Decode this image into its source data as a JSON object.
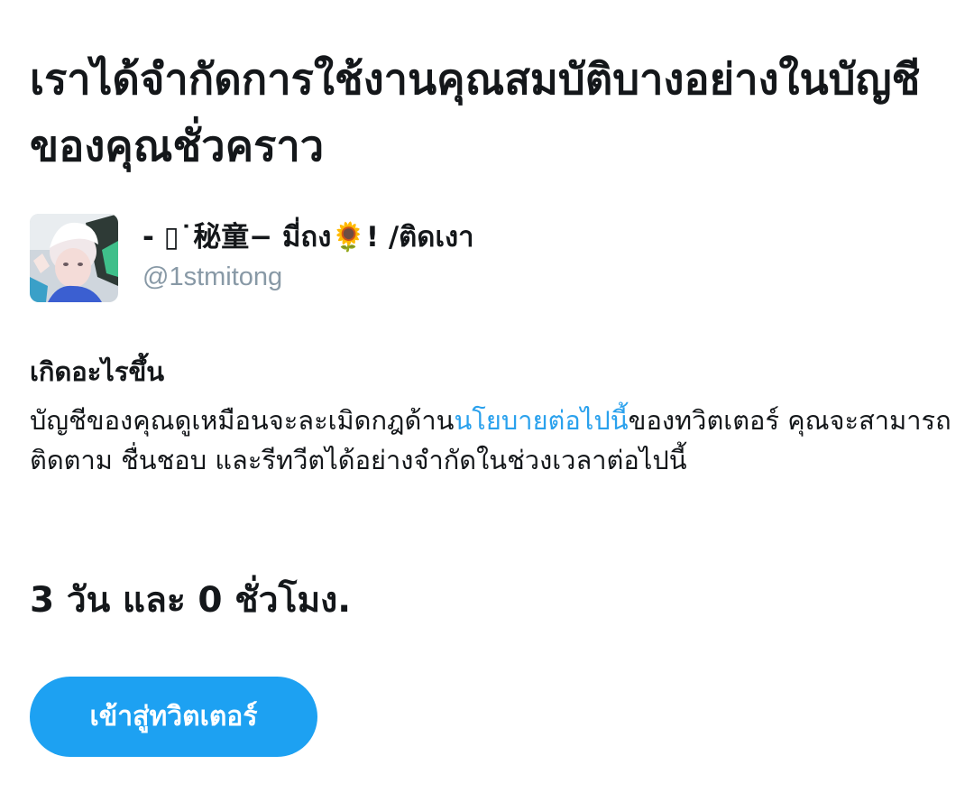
{
  "headline": "เราได้จำกัดการใช้งานคุณสมบัติบางอย่างในบัญชีของคุณชั่วคราว",
  "account": {
    "display_name": "- ▯˙秘童− มี่ถง🌻! /ติดเงา",
    "handle": "@1stmitong"
  },
  "details": {
    "heading": "เกิดอะไรขึ้น",
    "text_before_link": "บัญชีของคุณดูเหมือนจะละเมิดกฎด้าน",
    "link_text": "นโยบายต่อไปนี้",
    "text_after_link": "ของทวิตเตอร์ คุณจะสามารถติดตาม ชื่นชอบ และรีทวีตได้อย่างจำกัดในช่วงเวลาต่อไปนี้"
  },
  "duration": "3 วัน และ 0 ชั่วโมง.",
  "button_label": "เข้าสู่ทวิตเตอร์",
  "colors": {
    "accent": "#1da1f2",
    "link": "#2aa1ed",
    "muted": "#8899a6",
    "text": "#14171a"
  },
  "icons": {
    "avatar": "profile-photo"
  }
}
